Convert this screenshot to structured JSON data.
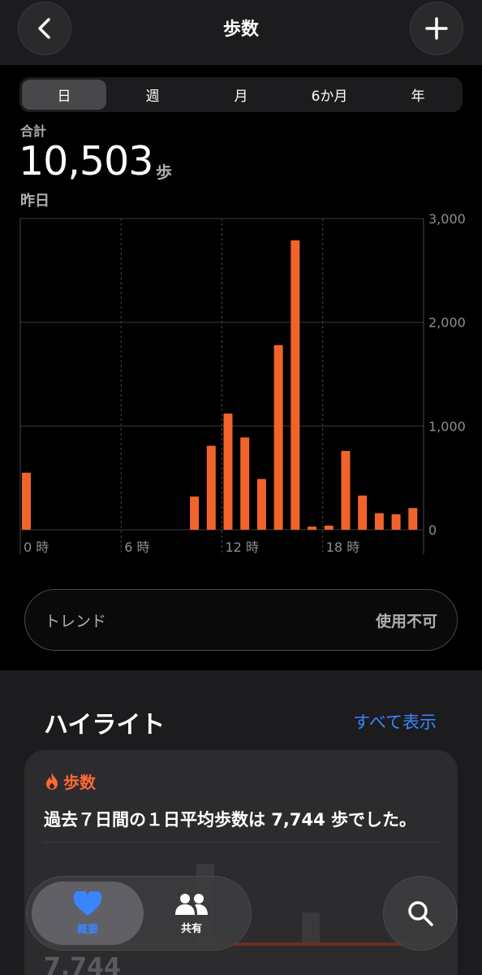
{
  "header": {
    "title": "歩数"
  },
  "segments": [
    {
      "label": "日",
      "active": true
    },
    {
      "label": "週",
      "active": false
    },
    {
      "label": "月",
      "active": false
    },
    {
      "label": "6か月",
      "active": false
    },
    {
      "label": "年",
      "active": false
    }
  ],
  "summary": {
    "label": "合計",
    "value": "10,503",
    "unit": "歩",
    "period": "昨日"
  },
  "chart_data": {
    "type": "bar",
    "x": [
      0,
      1,
      2,
      3,
      4,
      5,
      6,
      7,
      8,
      9,
      10,
      11,
      12,
      13,
      14,
      15,
      16,
      17,
      18,
      19,
      20,
      21,
      22,
      23
    ],
    "values": [
      550,
      0,
      0,
      0,
      0,
      0,
      0,
      0,
      0,
      0,
      320,
      810,
      1120,
      890,
      490,
      1780,
      2790,
      30,
      40,
      760,
      330,
      160,
      150,
      210
    ],
    "x_tick_labels": [
      "0 時",
      "6 時",
      "12 時",
      "18 時"
    ],
    "y_tick_labels": [
      "3,000",
      "2,000",
      "1,000",
      "0"
    ],
    "ylim": [
      0,
      3000
    ],
    "grid": true,
    "bar_color": "#f0642b"
  },
  "trend": {
    "label": "トレンド",
    "value": "使用不可"
  },
  "highlights": {
    "title": "ハイライト",
    "link": "すべて表示",
    "card": {
      "label": "歩数",
      "text": "過去７日間の１日平均歩数は 7,744 歩でした。",
      "partial_value": "7,744"
    }
  },
  "tabbar": {
    "items": [
      {
        "label": "概要",
        "active": true
      },
      {
        "label": "共有",
        "active": false
      }
    ]
  },
  "colors": {
    "accent": "#f0642b",
    "link": "#3a86ff",
    "background": "#000000",
    "panel": "#1c1c1e"
  }
}
